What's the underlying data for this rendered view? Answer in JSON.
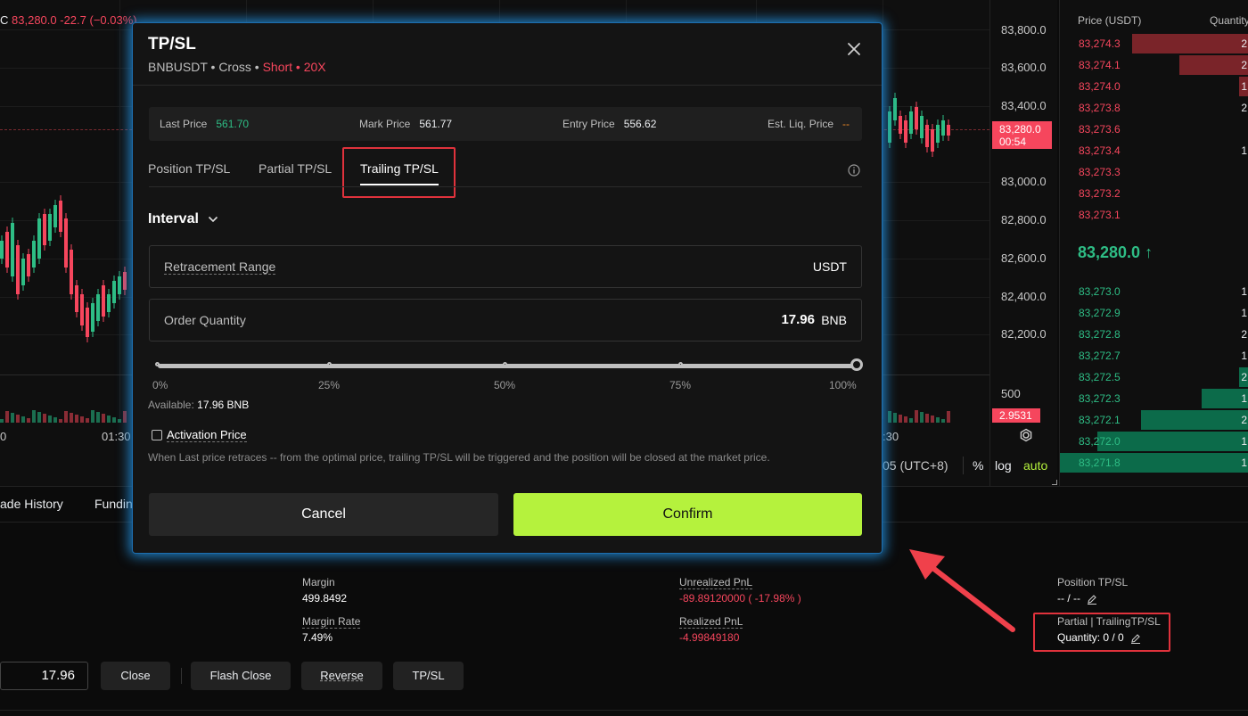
{
  "chart": {
    "ticker_prefix": "C",
    "ticker_price": "83,280.0",
    "ticker_change": "-22.7 (−0.03%)",
    "price_labels": [
      "83,800.0",
      "83,600.0",
      "83,400.0",
      "83,000.0",
      "82,800.0",
      "82,600.0",
      "82,400.0",
      "82,200.0"
    ],
    "current_price_tag": "83,280.0",
    "current_price_countdown": "00:54",
    "volume_axis_label": "500",
    "volume_tag": "2.9531",
    "time_labels": [
      "0",
      "01:30",
      ":30"
    ],
    "timezone": "05 (UTC+8)",
    "controls": {
      "percent": "%",
      "log": "log",
      "auto": "auto"
    }
  },
  "order_book": {
    "header_price": "Price (USDT)",
    "header_qty": "Quantity",
    "asks": [
      {
        "price": "83,274.3",
        "qty": "2",
        "fill": 0.62
      },
      {
        "price": "83,274.1",
        "qty": "2",
        "fill": 0.37
      },
      {
        "price": "83,274.0",
        "qty": "1",
        "fill": 0.05
      },
      {
        "price": "83,273.8",
        "qty": "2",
        "fill": 0
      },
      {
        "price": "83,273.6",
        "qty": "",
        "fill": 0
      },
      {
        "price": "83,273.4",
        "qty": "1",
        "fill": 0
      },
      {
        "price": "83,273.3",
        "qty": "",
        "fill": 0
      },
      {
        "price": "83,273.2",
        "qty": "",
        "fill": 0
      },
      {
        "price": "83,273.1",
        "qty": "",
        "fill": 0
      }
    ],
    "mid_price": "83,280.0 ↑",
    "bids": [
      {
        "price": "83,273.0",
        "qty": "1",
        "fill": 0
      },
      {
        "price": "83,272.9",
        "qty": "1",
        "fill": 0
      },
      {
        "price": "83,272.8",
        "qty": "2",
        "fill": 0
      },
      {
        "price": "83,272.7",
        "qty": "1",
        "fill": 0
      },
      {
        "price": "83,272.5",
        "qty": "2",
        "fill": 0.05
      },
      {
        "price": "83,272.3",
        "qty": "1",
        "fill": 0.25
      },
      {
        "price": "83,272.1",
        "qty": "2",
        "fill": 0.57
      },
      {
        "price": "83,272.0",
        "qty": "1",
        "fill": 0.8
      },
      {
        "price": "83,271.8",
        "qty": "1",
        "fill": 1.0
      }
    ]
  },
  "modal": {
    "title": "TP/SL",
    "subtitle_symbol": "BNBUSDT • Cross •",
    "subtitle_side": "Short • 20X",
    "info": {
      "last_price_label": "Last Price",
      "last_price": "561.70",
      "mark_price_label": "Mark Price",
      "mark_price": "561.77",
      "entry_price_label": "Entry Price",
      "entry_price": "556.62",
      "liq_price_label": "Est. Liq. Price",
      "liq_price": "--"
    },
    "tabs": [
      "Position TP/SL",
      "Partial TP/SL",
      "Trailing TP/SL"
    ],
    "active_tab": 2,
    "interval_label": "Interval",
    "retracement_label": "Retracement Range",
    "retracement_unit": "USDT",
    "order_qty_label": "Order Quantity",
    "order_qty_value": "17.96",
    "order_qty_unit": "BNB",
    "slider_value_percent": 100,
    "slider_marks": [
      "0%",
      "25%",
      "50%",
      "75%",
      "100%"
    ],
    "available_label": "Available:",
    "available_value": "17.96 BNB",
    "activation_label": "Activation Price",
    "note": "When Last price retraces -- from the optimal price, trailing TP/SL will be triggered and the position will be closed at the market price.",
    "cancel_label": "Cancel",
    "confirm_label": "Confirm"
  },
  "bottom": {
    "tabs": [
      "ade History",
      "Fundin"
    ],
    "margin_label": "Margin",
    "margin_value": "499.8492",
    "margin_rate_label": "Margin Rate",
    "margin_rate_value": "7.49%",
    "upnl_label": "Unrealized PnL",
    "upnl_value": "-89.89120000 ( -17.98% )",
    "rpnl_label": "Realized PnL",
    "rpnl_value": "-4.99849180",
    "pos_tpsl_label": "Position TP/SL",
    "pos_tpsl_value": "-- / --",
    "partial_label": "Partial | TrailingTP/SL",
    "partial_value": "Quantity: 0 / 0",
    "qty_input_value": "17.96",
    "buttons": {
      "close": "Close",
      "flash_close": "Flash Close",
      "reverse": "Reverse",
      "tpsl": "TP/SL"
    }
  },
  "colors": {
    "accent": "#b5f23d",
    "up": "#2ebd85",
    "down": "#f6465d",
    "annotation": "#e0323c"
  }
}
